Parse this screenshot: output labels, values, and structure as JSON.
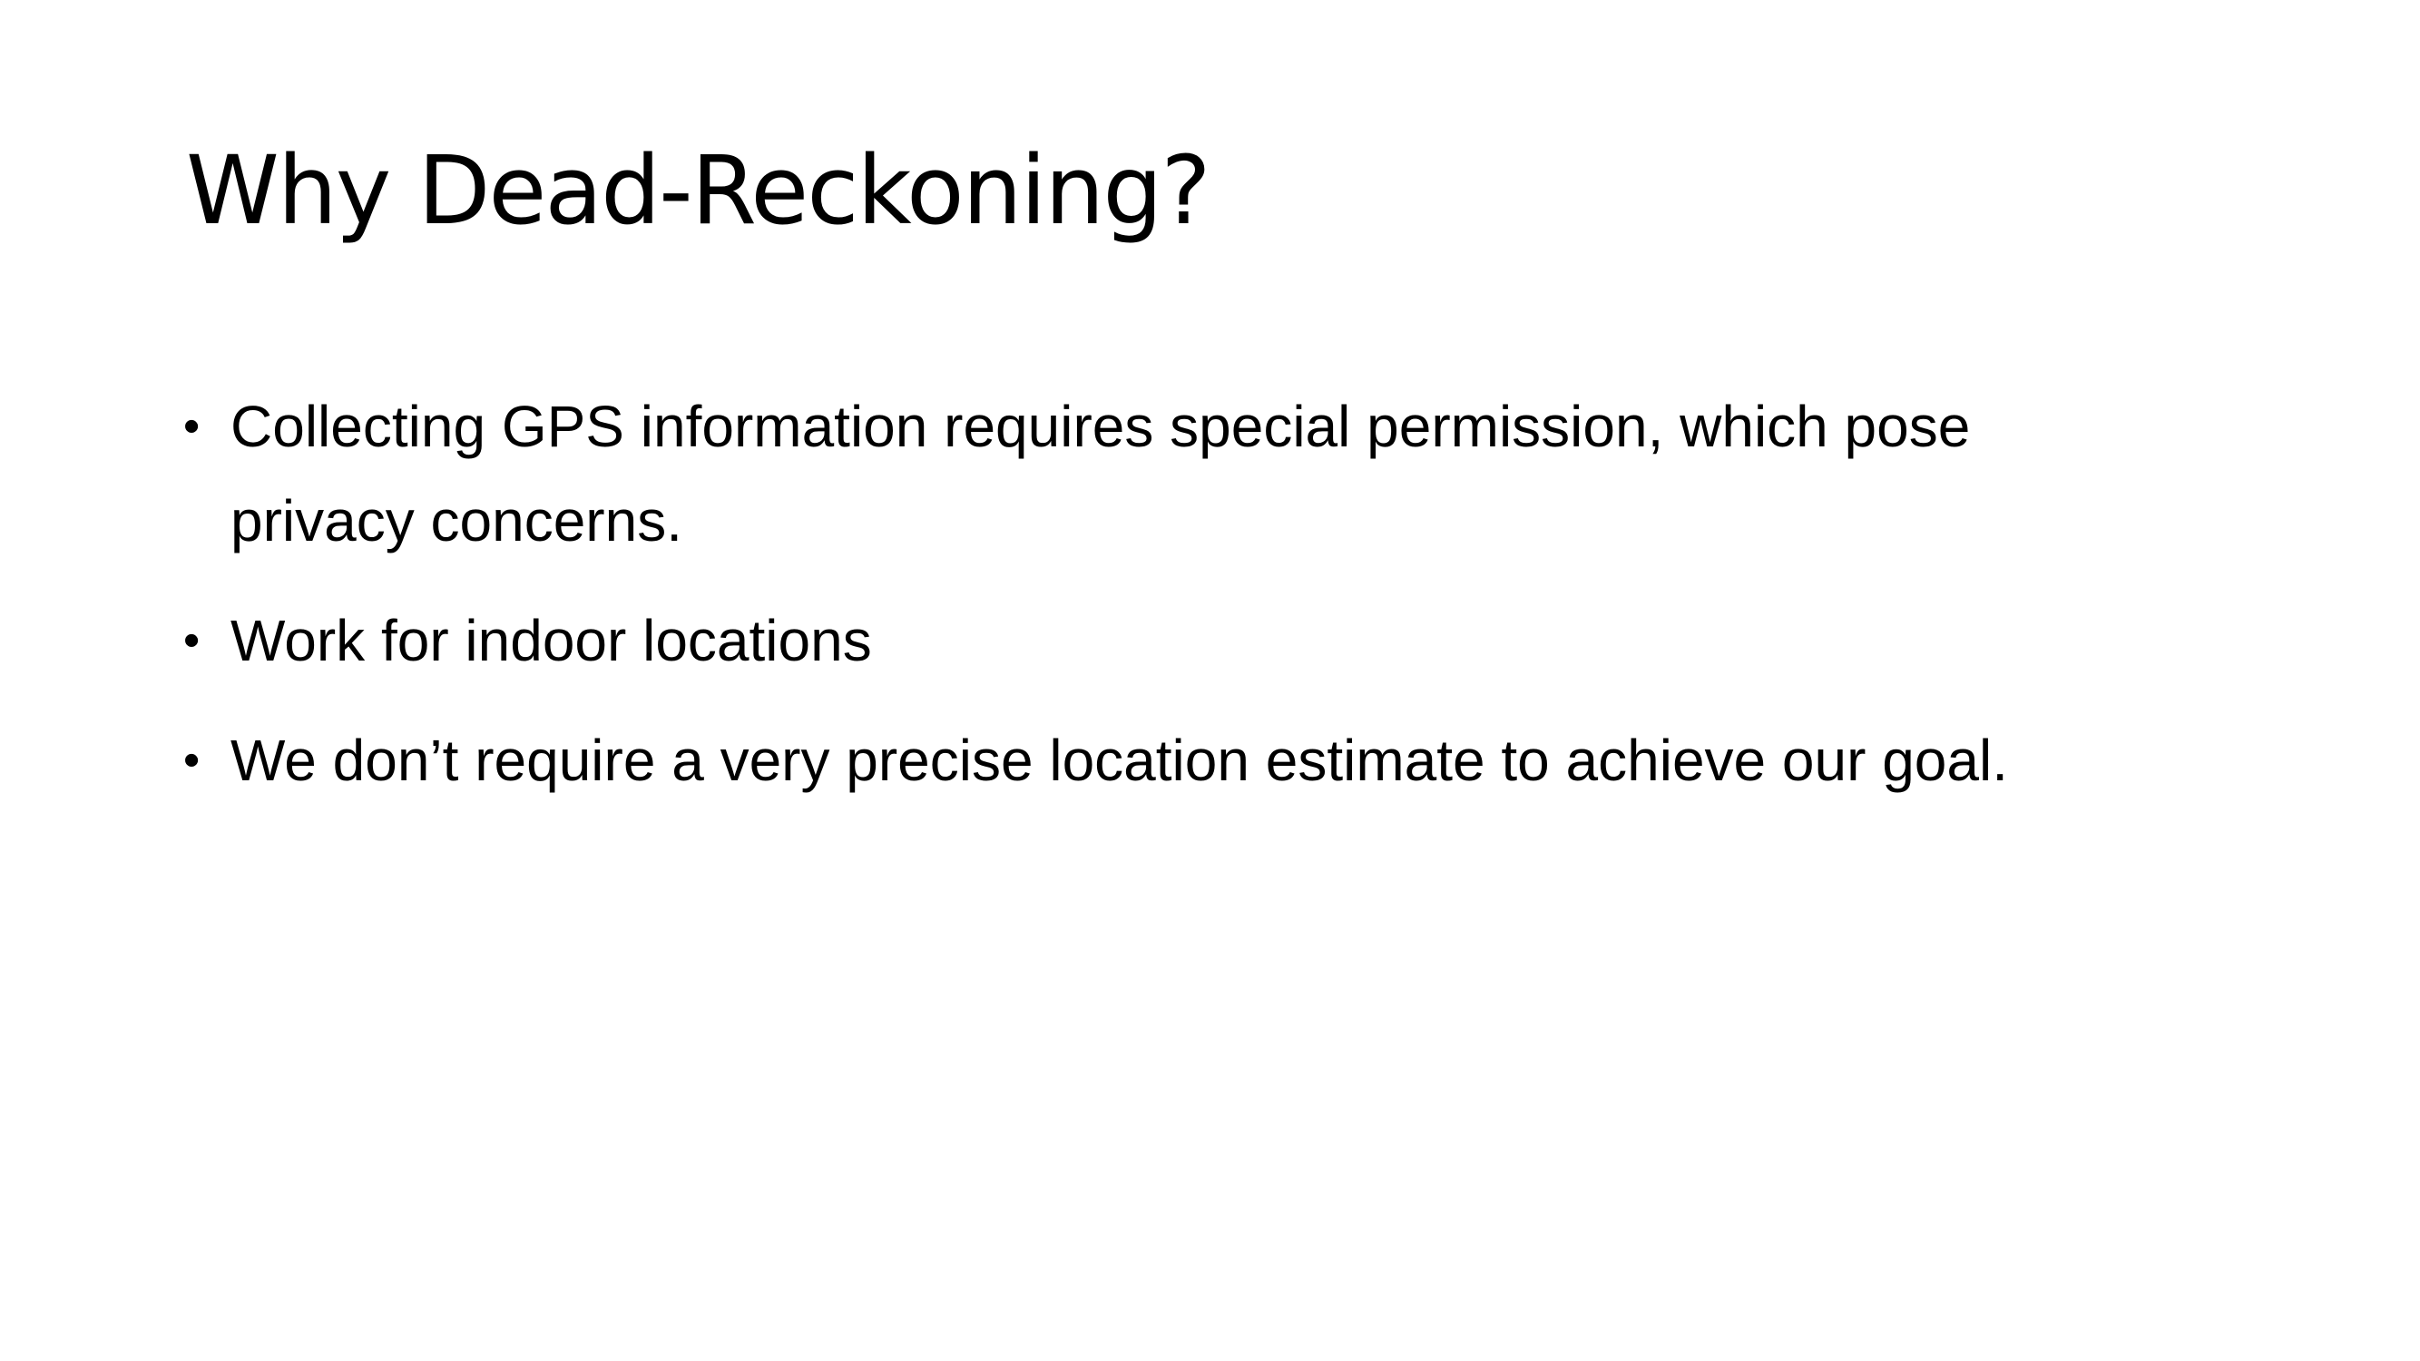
{
  "slide": {
    "title": "Why Dead-Reckoning?",
    "bullets": [
      {
        "mark": "•",
        "text": "Collecting GPS information requires special permission, which pose privacy concerns."
      },
      {
        "mark": "•",
        "text": "Work for indoor locations"
      },
      {
        "mark": "•",
        "text": "We don’t require a very precise location estimate to achieve our goal."
      }
    ]
  }
}
